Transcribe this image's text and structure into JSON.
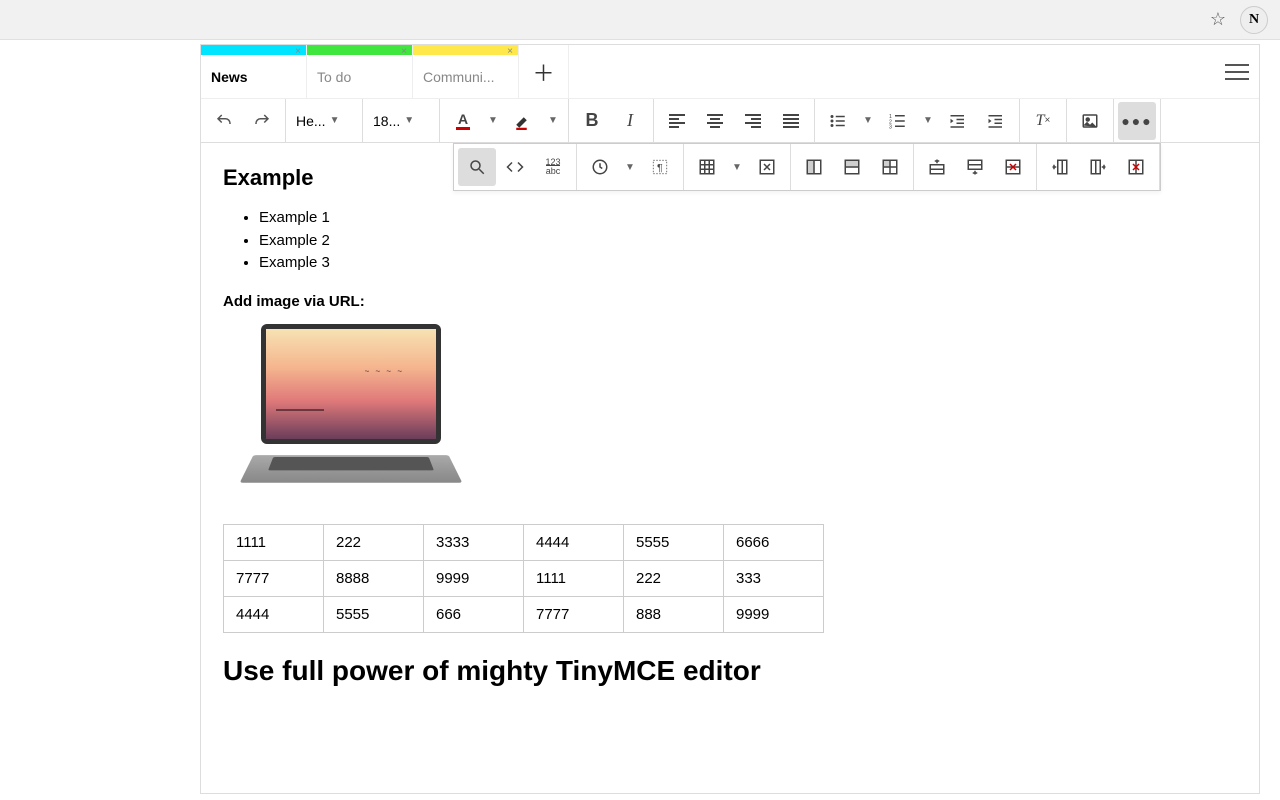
{
  "browser": {
    "ext_letter": "N"
  },
  "tabs": [
    {
      "label": "News",
      "color": "#00e5ff",
      "active": true
    },
    {
      "label": "To do",
      "color": "#3ee63e",
      "active": false
    },
    {
      "label": "Communi...",
      "color": "#ffe94a",
      "active": false
    }
  ],
  "toolbar": {
    "heading_label": "He...",
    "fontsize_label": "18..."
  },
  "content": {
    "heading": "Example",
    "list": [
      "Example 1",
      "Example 2",
      "Example 3"
    ],
    "subhead": "Add image via URL:",
    "table": [
      [
        "1111",
        "222",
        "3333",
        "4444",
        "5555",
        "6666"
      ],
      [
        "7777",
        "8888",
        "9999",
        "1111",
        "222",
        "333"
      ],
      [
        "4444",
        "5555",
        "666",
        "7777",
        "888",
        "9999"
      ]
    ],
    "big_heading": "Use full power of mighty TinyMCE editor"
  }
}
